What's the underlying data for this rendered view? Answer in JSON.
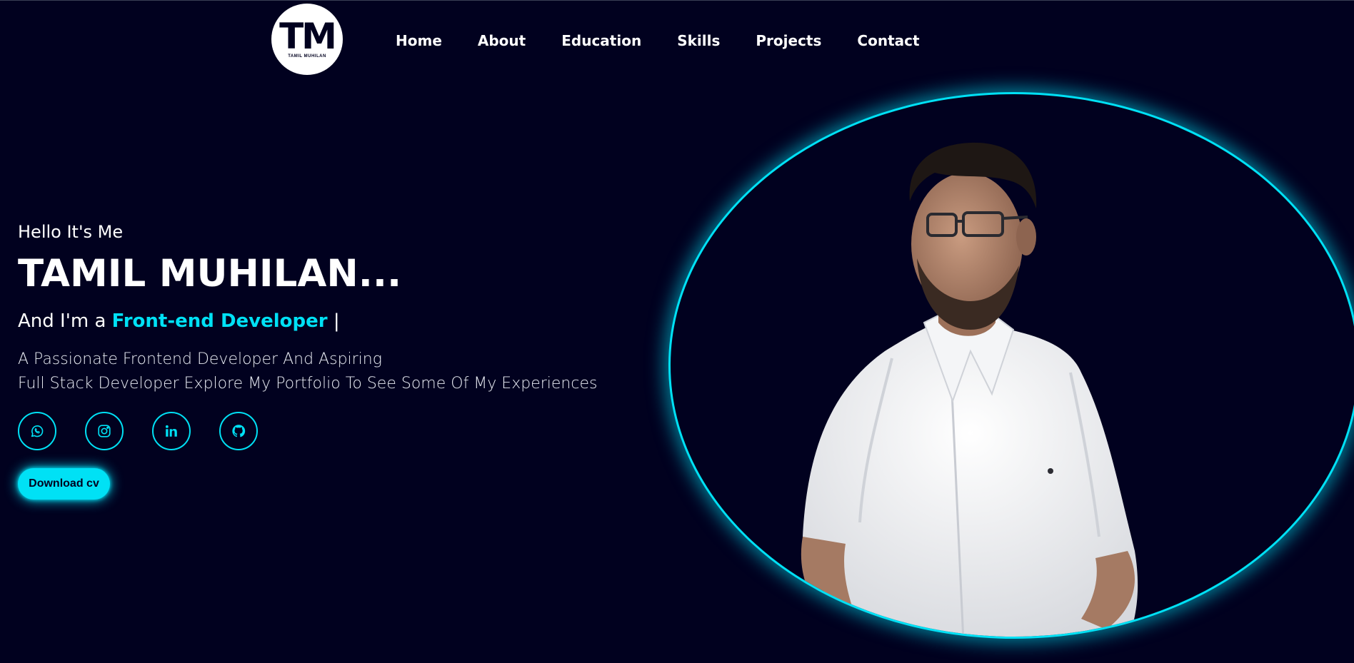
{
  "logo": {
    "mark": "TM",
    "subtitle": "TAMIL MUHILAN"
  },
  "nav": [
    "Home",
    "About",
    "Education",
    "Skills",
    "Projects",
    "Contact"
  ],
  "hero": {
    "greeting": "Hello It's Me",
    "name": "TAMIL MUHILAN...",
    "role_prefix": "And I'm a ",
    "role_highlight": "Front-end Developer",
    "role_cursor": " |",
    "description_line1": "A Passionate Frontend Developer And Aspiring",
    "description_line2": "Full Stack Developer Explore My Portfolio To See Some Of My Experiences"
  },
  "socials": [
    {
      "icon": "whatsapp-icon"
    },
    {
      "icon": "instagram-icon"
    },
    {
      "icon": "linkedin-icon"
    },
    {
      "icon": "github-icon"
    }
  ],
  "download_button": {
    "label": "Download cv"
  },
  "colors": {
    "background": "#01011f",
    "accent": "#00e1f5",
    "text": "#ffffff"
  }
}
